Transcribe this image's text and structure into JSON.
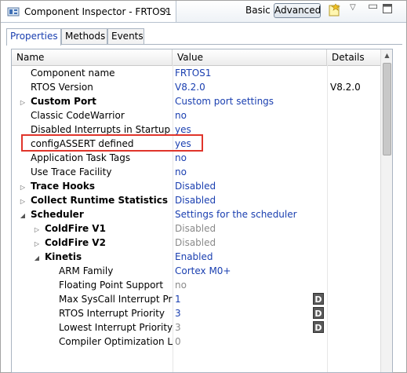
{
  "view": {
    "title": "Component Inspector - FRTOS1",
    "close_glyph": "✕",
    "basic_label": "Basic",
    "advanced_label": "Advanced",
    "icons": [
      "component-inspector-icon",
      "new-note-icon",
      "view-menu-icon",
      "minimize-icon",
      "maximize-icon"
    ]
  },
  "tabs": [
    "Properties",
    "Methods",
    "Events"
  ],
  "active_tab": "Properties",
  "table": {
    "headers": [
      "Name",
      "Value",
      "Details"
    ],
    "rows": [
      {
        "indent": 0,
        "expander": "",
        "bold": false,
        "name": "Component name",
        "value": "FRTOS1",
        "details": "",
        "disabled": false,
        "d": false
      },
      {
        "indent": 0,
        "expander": "",
        "bold": false,
        "name": "RTOS Version",
        "value": "V8.2.0",
        "details": "V8.2.0",
        "disabled": false,
        "d": false
      },
      {
        "indent": 0,
        "expander": "▷",
        "bold": true,
        "name": "Custom Port",
        "value": "Custom port settings",
        "details": "",
        "disabled": false,
        "d": false
      },
      {
        "indent": 0,
        "expander": "",
        "bold": false,
        "name": "Classic CodeWarrior",
        "value": "no",
        "details": "",
        "disabled": false,
        "d": false
      },
      {
        "indent": 0,
        "expander": "",
        "bold": false,
        "name": "Disabled Interrupts in Startup",
        "value": "yes",
        "details": "",
        "disabled": false,
        "d": false
      },
      {
        "indent": 0,
        "expander": "",
        "bold": false,
        "name": "configASSERT defined",
        "value": "yes",
        "details": "",
        "disabled": false,
        "d": false
      },
      {
        "indent": 0,
        "expander": "",
        "bold": false,
        "name": "Application Task Tags",
        "value": "no",
        "details": "",
        "disabled": false,
        "d": false
      },
      {
        "indent": 0,
        "expander": "",
        "bold": false,
        "name": "Use Trace Facility",
        "value": "no",
        "details": "",
        "disabled": false,
        "d": false
      },
      {
        "indent": 0,
        "expander": "▷",
        "bold": true,
        "name": "Trace Hooks",
        "value": "Disabled",
        "details": "",
        "disabled": false,
        "d": false
      },
      {
        "indent": 0,
        "expander": "▷",
        "bold": true,
        "name": "Collect Runtime Statistics",
        "value": "Disabled",
        "details": "",
        "disabled": false,
        "d": false
      },
      {
        "indent": 0,
        "expander": "◢",
        "bold": true,
        "name": "Scheduler",
        "value": "Settings for the scheduler",
        "details": "",
        "disabled": false,
        "d": false
      },
      {
        "indent": 1,
        "expander": "▷",
        "bold": true,
        "name": "ColdFire V1",
        "value": "Disabled",
        "details": "",
        "disabled": true,
        "d": false
      },
      {
        "indent": 1,
        "expander": "▷",
        "bold": true,
        "name": "ColdFire V2",
        "value": "Disabled",
        "details": "",
        "disabled": true,
        "d": false
      },
      {
        "indent": 1,
        "expander": "◢",
        "bold": true,
        "name": "Kinetis",
        "value": "Enabled",
        "details": "",
        "disabled": false,
        "d": false
      },
      {
        "indent": 2,
        "expander": "",
        "bold": false,
        "name": "ARM Family",
        "value": "Cortex M0+",
        "details": "",
        "disabled": false,
        "d": false
      },
      {
        "indent": 2,
        "expander": "",
        "bold": false,
        "name": "Floating Point Support",
        "value": "no",
        "details": "",
        "disabled": true,
        "d": false
      },
      {
        "indent": 2,
        "expander": "",
        "bold": false,
        "name": "Max SysCall Interrupt Priori",
        "value": "1",
        "details": "",
        "disabled": false,
        "d": true
      },
      {
        "indent": 2,
        "expander": "",
        "bold": false,
        "name": "RTOS Interrupt Priority",
        "value": "3",
        "details": "",
        "disabled": false,
        "d": true
      },
      {
        "indent": 2,
        "expander": "",
        "bold": false,
        "name": "Lowest Interrupt Priority",
        "value": "3",
        "details": "",
        "disabled": true,
        "d": true
      },
      {
        "indent": 2,
        "expander": "",
        "bold": false,
        "name": "Compiler Optimization Lev",
        "value": "0",
        "details": "",
        "disabled": true,
        "d": false
      }
    ],
    "d_badge_label": "D",
    "highlight_row": "configASSERT defined",
    "highlight_color": "#e0352b"
  }
}
